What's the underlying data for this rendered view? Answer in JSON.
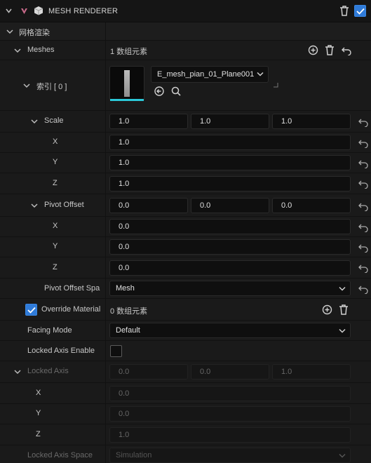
{
  "header": {
    "title": "MESH RENDERER",
    "enabled": true
  },
  "section": {
    "title": "网格渲染"
  },
  "meshes": {
    "label": "Meshes",
    "count_text": "1 数组元素"
  },
  "index0": {
    "label": "索引 [ 0 ]",
    "mesh_name": "E_mesh_pian_01_Plane001"
  },
  "scale": {
    "label": "Scale",
    "x": "1.0",
    "y": "1.0",
    "z": "1.0",
    "x_label": "X",
    "y_label": "Y",
    "z_label": "Z"
  },
  "pivot_offset": {
    "label": "Pivot Offset",
    "x": "0.0",
    "y": "0.0",
    "z": "0.0",
    "x_label": "X",
    "y_label": "Y",
    "z_label": "Z"
  },
  "pivot_offset_space": {
    "label": "Pivot Offset Spa",
    "value": "Mesh"
  },
  "override_material": {
    "label": "Override Material",
    "checked": true,
    "count_text": "0 数组元素"
  },
  "facing_mode": {
    "label": "Facing Mode",
    "value": "Default"
  },
  "locked_axis_enable": {
    "label": "Locked Axis Enable",
    "checked": false
  },
  "locked_axis": {
    "label": "Locked Axis",
    "x": "0.0",
    "y": "0.0",
    "z": "1.0",
    "x_label": "X",
    "y_label": "Y",
    "z_label": "Z"
  },
  "locked_axis_space": {
    "label": "Locked Axis Space",
    "value": "Simulation"
  },
  "colors": {
    "accent": "#2f7bd9",
    "thumb_underline": "#2bc8d8"
  }
}
